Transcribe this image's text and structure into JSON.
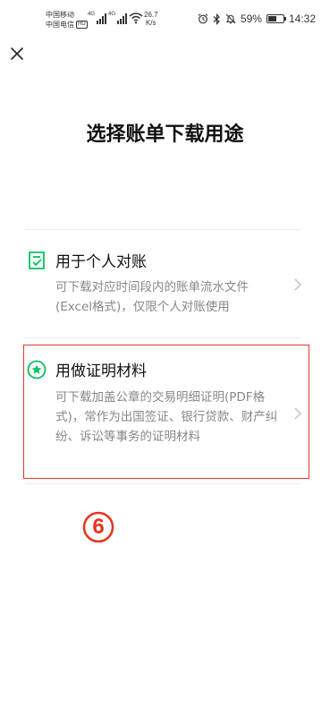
{
  "status_bar": {
    "carrier_top": "中国移动",
    "carrier_bottom": "中国电信",
    "hd_badge": "HD",
    "signal1_label": "4G",
    "signal2_label": "4G",
    "net_speed_value": "26.7",
    "net_speed_unit": "K/s",
    "battery_percent": "59%",
    "battery_level": 0.59,
    "time": "14:32"
  },
  "page": {
    "title": "选择账单下载用途"
  },
  "options": [
    {
      "title": "用于个人对账",
      "description": "可下载对应时间段内的账单流水文件(Excel格式)，仅限个人对账使用",
      "icon": "checklist-icon"
    },
    {
      "title": "用做证明材料",
      "description": "可下载加盖公章的交易明细证明(PDF格式)，常作为出国签证、银行贷款、财产纠纷、诉讼等事务的证明材料",
      "icon": "star-circle-icon"
    }
  ],
  "annotation": {
    "step_number": "⑥"
  },
  "colors": {
    "accent_green": "#07c160",
    "highlight_red": "#e23b2e",
    "annotation_red": "#e8321f"
  }
}
